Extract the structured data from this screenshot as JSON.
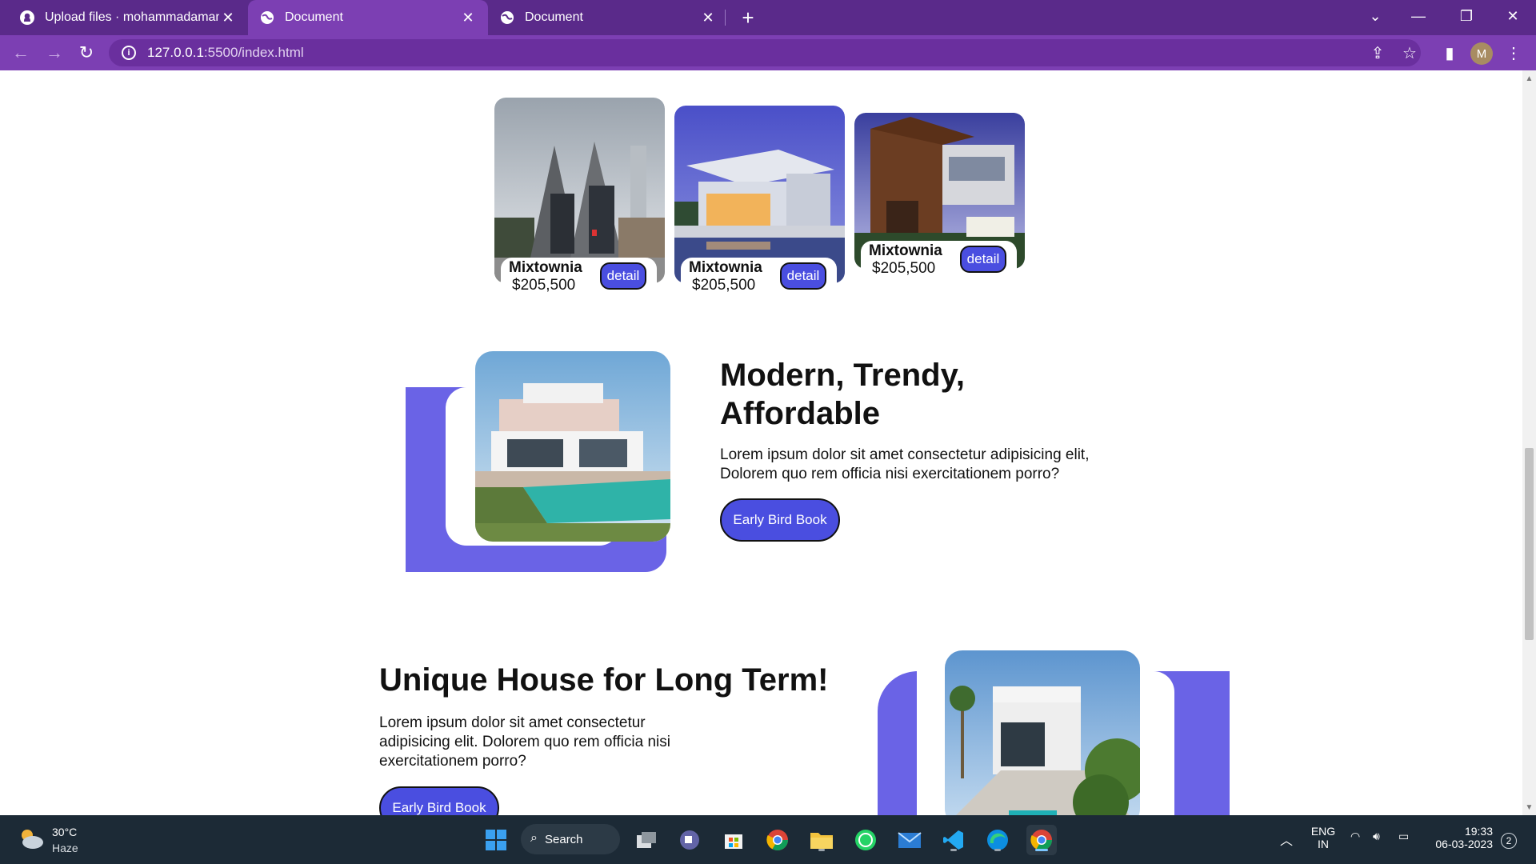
{
  "browser": {
    "tabs": [
      {
        "title": "Upload files · mohammadamanp",
        "icon": "github-icon",
        "active": false
      },
      {
        "title": "Document",
        "icon": "globe-icon",
        "active": true
      },
      {
        "title": "Document",
        "icon": "globe-icon",
        "active": false
      }
    ],
    "address": {
      "host": "127.0.0.1",
      "path": ":5500/index.html"
    },
    "profile_initial": "M"
  },
  "cards": [
    {
      "name": "Mixtownia",
      "price": "$205,500",
      "button": "detail"
    },
    {
      "name": "Mixtownia",
      "price": "$205,500",
      "button": "detail"
    },
    {
      "name": "Mixtownia",
      "price": "$205,500",
      "button": "detail"
    }
  ],
  "section_modern": {
    "heading_line1": "Modern, Trendy,",
    "heading_line2": "Affordable",
    "text_line1": "Lorem ipsum dolor sit amet consectetur adipisicing elit,",
    "text_line2": "Dolorem quo rem officia nisi exercitationem porro?",
    "button": "Early Bird Book"
  },
  "section_unique": {
    "heading": "Unique House for Long Term!",
    "text_line1": "Lorem ipsum dolor sit amet consectetur",
    "text_line2": "adipisicing elit. Dolorem quo rem officia nisi",
    "text_line3": "exercitationem porro?",
    "button": "Early Bird Book"
  },
  "colors": {
    "tabbar": "#5a2a8a",
    "toolbar": "#7c3fb3",
    "accent_blob": "#6a63e6",
    "button": "#4a4ee0",
    "taskbar": "#1c2a36"
  },
  "taskbar": {
    "weather_temp": "30°C",
    "weather_desc": "Haze",
    "search_label": "Search",
    "lang_line1": "ENG",
    "lang_line2": "IN",
    "time": "19:33",
    "date": "06-03-2023",
    "notification_count": "2"
  }
}
